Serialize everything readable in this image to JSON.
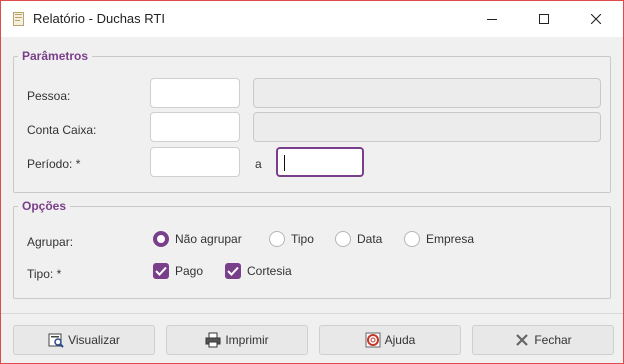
{
  "window": {
    "title": "Relatório - Duchas RTI"
  },
  "params": {
    "legend": "Parâmetros",
    "pessoa_label": "Pessoa:",
    "conta_label": "Conta Caixa:",
    "periodo_label": "Período: *",
    "periodo_sep": "a"
  },
  "options": {
    "legend": "Opções",
    "agrupar_label": "Agrupar:",
    "radios": [
      "Não agrupar",
      "Tipo",
      "Data",
      "Empresa"
    ],
    "selected_radio": "Não agrupar",
    "tipo_label": "Tipo: *",
    "checks": [
      "Pago",
      "Cortesia"
    ]
  },
  "buttons": {
    "visualizar": "Visualizar",
    "imprimir": "Imprimir",
    "ajuda": "Ajuda",
    "fechar": "Fechar"
  },
  "colors": {
    "accent": "#7a3f8a",
    "border_focus": "#e04a4a"
  },
  "icons": [
    "document-icon",
    "minimize-icon",
    "maximize-icon",
    "close-icon",
    "preview-icon",
    "printer-icon",
    "help-icon",
    "close-x-icon"
  ]
}
